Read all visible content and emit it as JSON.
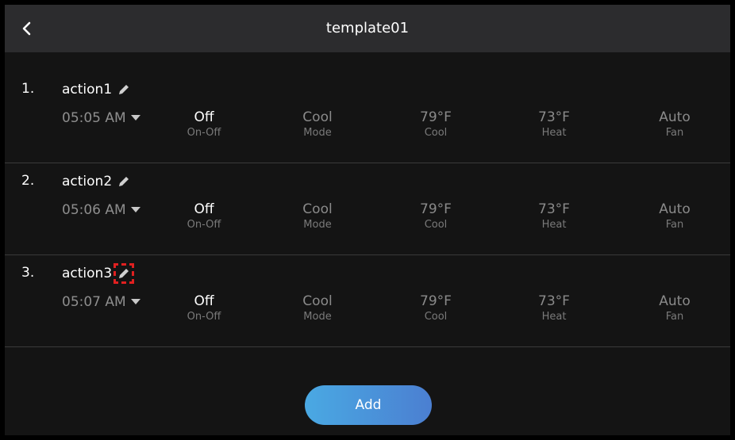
{
  "header": {
    "title": "template01",
    "back_icon": "chevron-left-icon"
  },
  "actions": [
    {
      "index": "1.",
      "name": "action1",
      "time": "05:05 AM",
      "fields": [
        {
          "value": "Off",
          "label": "On-Off"
        },
        {
          "value": "Cool",
          "label": "Mode"
        },
        {
          "value": "79°F",
          "label": "Cool"
        },
        {
          "value": "73°F",
          "label": "Heat"
        },
        {
          "value": "Auto",
          "label": "Fan"
        }
      ]
    },
    {
      "index": "2.",
      "name": "action2",
      "time": "05:06 AM",
      "fields": [
        {
          "value": "Off",
          "label": "On-Off"
        },
        {
          "value": "Cool",
          "label": "Mode"
        },
        {
          "value": "79°F",
          "label": "Cool"
        },
        {
          "value": "73°F",
          "label": "Heat"
        },
        {
          "value": "Auto",
          "label": "Fan"
        }
      ]
    },
    {
      "index": "3.",
      "name": "action3",
      "time": "05:07 AM",
      "fields": [
        {
          "value": "Off",
          "label": "On-Off"
        },
        {
          "value": "Cool",
          "label": "Mode"
        },
        {
          "value": "79°F",
          "label": "Cool"
        },
        {
          "value": "73°F",
          "label": "Heat"
        },
        {
          "value": "Auto",
          "label": "Fan"
        }
      ]
    }
  ],
  "add_label": "Add",
  "colors": {
    "accent_start": "#4aa9e3",
    "accent_end": "#4b7fd1",
    "highlight": "#e02020"
  }
}
